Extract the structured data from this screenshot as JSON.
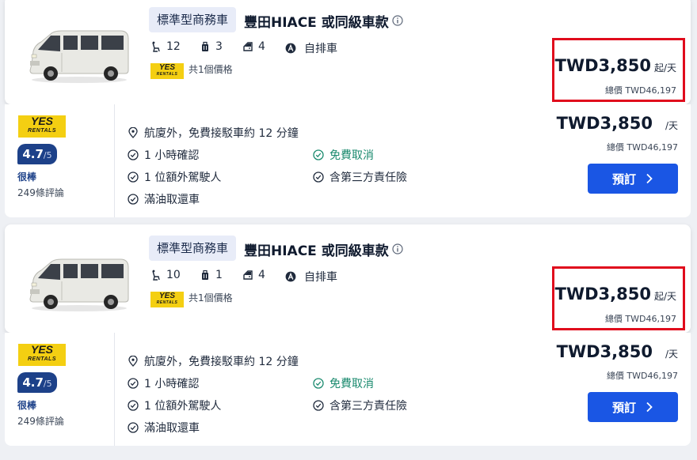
{
  "listings": [
    {
      "category": "標準型商務車",
      "title": "豐田HIACE 或同級車款",
      "seats": "12",
      "bags": "3",
      "doors": "4",
      "transmission": "自排車",
      "price_count": "共1個價格",
      "from_price": "TWD3,850",
      "from_unit": "起/天",
      "from_total": "總價 TWD46,197",
      "vendor": {
        "logo_line1": "YES",
        "logo_line2": "RENTALS",
        "rating": "4.7",
        "rating_max": "/5",
        "rating_word": "很棒",
        "reviews": "249條評論"
      },
      "features": {
        "location": "航廈外，免費接駁車約 12 分鐘",
        "confirm": "1 小時確認",
        "free_cancel": "免費取消",
        "driver": "1 位額外駕駛人",
        "insurance": "含第三方責任險",
        "fuel": "滿油取還車"
      },
      "offer_price": "TWD3,850",
      "offer_unit": "/天",
      "offer_total": "總價 TWD46,197",
      "book_label": "預訂"
    },
    {
      "category": "標準型商務車",
      "title": "豐田HIACE 或同級車款",
      "seats": "10",
      "bags": "1",
      "doors": "4",
      "transmission": "自排車",
      "price_count": "共1個價格",
      "from_price": "TWD3,850",
      "from_unit": "起/天",
      "from_total": "總價 TWD46,197",
      "vendor": {
        "logo_line1": "YES",
        "logo_line2": "RENTALS",
        "rating": "4.7",
        "rating_max": "/5",
        "rating_word": "很棒",
        "reviews": "249條評論"
      },
      "features": {
        "location": "航廈外，免費接駁車約 12 分鐘",
        "confirm": "1 小時確認",
        "free_cancel": "免費取消",
        "driver": "1 位額外駕駛人",
        "insurance": "含第三方責任險",
        "fuel": "滿油取還車"
      },
      "offer_price": "TWD3,850",
      "offer_unit": "/天",
      "offer_total": "總價 TWD46,197",
      "book_label": "預訂"
    }
  ],
  "colors": {
    "accent": "#1a56e4",
    "highlight_border": "#e00b1c",
    "vendor_yellow": "#f4cf12",
    "rating_bg": "#1d4189",
    "free_cancel": "#1a8a6e"
  },
  "icons": {
    "seats": "car-seat-icon",
    "bags": "luggage-icon",
    "doors": "door-icon",
    "transmission": "automatic-transmission-icon",
    "location": "location-pin-icon",
    "check": "check-circle-icon",
    "info": "info-icon",
    "chevron": "chevron-right-icon"
  }
}
